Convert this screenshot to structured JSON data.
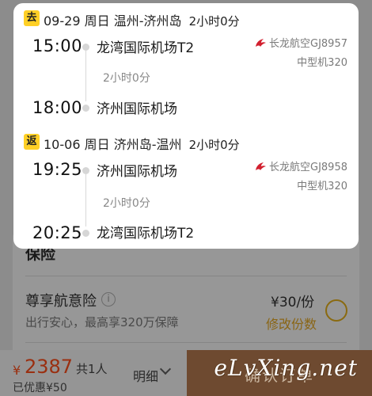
{
  "legs": [
    {
      "badge": "去",
      "date": "09-29",
      "weekday": "周日",
      "route": "温州-济州岛",
      "duration": "2小时0分",
      "depart_time": "15:00",
      "depart_airport": "龙湾国际机场T2",
      "mid_duration": "2小时0分",
      "arrive_time": "18:00",
      "arrive_airport": "济州国际机场",
      "airline": "长龙航空GJ8957",
      "aircraft": "中型机320"
    },
    {
      "badge": "返",
      "date": "10-06",
      "weekday": "周日",
      "route": "济州岛-温州",
      "duration": "2小时0分",
      "depart_time": "19:25",
      "depart_airport": "济州国际机场",
      "mid_duration": "2小时0分",
      "arrive_time": "20:25",
      "arrive_airport": "龙湾国际机场T2",
      "airline": "长龙航空GJ8958",
      "aircraft": "中型机320"
    }
  ],
  "insurance": {
    "section_title": "保险",
    "name": "尊享航意险",
    "description": "出行安心，最高享320万保障",
    "price": "¥30/份",
    "modify_label": "修改份数"
  },
  "bottom_bar": {
    "currency": "¥",
    "total": "2387",
    "count": "共1人",
    "discount": "已优惠¥50",
    "detail_label": "明细",
    "submit_label": "确认订单"
  },
  "watermark": "eLvXing.net",
  "colors": {
    "badge": "#ffd026",
    "price": "#e4551b",
    "airline_logo": "#d2202f"
  }
}
